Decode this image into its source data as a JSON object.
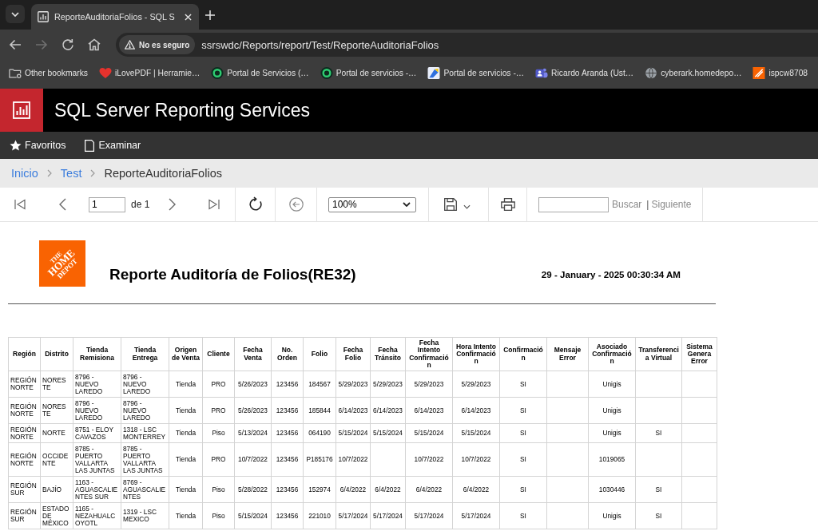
{
  "browser": {
    "tabs": [
      {
        "title": "ReporteAuditoriaFolios - SQL S",
        "selected": true
      }
    ],
    "nav_buttons": [
      {
        "kind": "back",
        "disabled": false
      },
      {
        "kind": "forward",
        "disabled": true
      },
      {
        "kind": "reload",
        "disabled": false
      },
      {
        "kind": "home",
        "disabled": false
      }
    ],
    "security_chip": "No es seguro",
    "url": "ssrswdc/Reports/report/Test/ReporteAuditoriaFolios",
    "bookmarks": [
      {
        "kind": "folder",
        "label": "Other bookmarks"
      },
      {
        "kind": "heart",
        "label": "iLovePDF | Herramie…"
      },
      {
        "kind": "ring",
        "label": "Portal de Servicios (…"
      },
      {
        "kind": "ring",
        "label": "Portal de servicios -…"
      },
      {
        "kind": "page",
        "label": "Portal de servicios -…"
      },
      {
        "kind": "people",
        "label": "Ricardo Aranda (Ust…"
      },
      {
        "kind": "globe",
        "label": "cyberark.homedepo…"
      },
      {
        "kind": "tile",
        "label": "ispcw8708"
      }
    ]
  },
  "app": {
    "title": "SQL Server Reporting Services",
    "nav": [
      {
        "kind": "star",
        "label": "Favoritos"
      },
      {
        "kind": "document",
        "label": "Examinar"
      }
    ],
    "breadcrumb": [
      {
        "label": "Inicio",
        "current": false
      },
      {
        "label": "Test",
        "current": false
      },
      {
        "label": "ReporteAuditoriaFolios",
        "current": true
      }
    ]
  },
  "report_toolbar": {
    "page": "1",
    "page_count": "de 1",
    "zoom": "100%",
    "find_button": "Buscar",
    "separator": "|",
    "next_button": "Siguiente"
  },
  "report": {
    "logo_text": [
      "THE",
      "HOME",
      "DEPOT"
    ],
    "title": "Reporte Auditoría de Folios(RE32)",
    "timestamp": "29 - January - 2025 00:30:34 AM",
    "table": {
      "columns": [
        "Región",
        "Distrito",
        "Tienda Remisiona",
        "Tienda Entrega",
        "Origen de Venta",
        "Cliente",
        "Fecha Venta",
        "No. Orden",
        "Folio",
        "Fecha Folio",
        "Fecha Tránsito",
        "Fecha Intento Confirmación",
        "Hora Intento Confirmación",
        "Confirmación",
        "Mensaje Error",
        "Asociado Confirmación",
        "Transferencia Virtual",
        "Sistema Genera Error"
      ],
      "rows": [
        [
          "REGIÓN NORTE",
          "NORESTE",
          "8796 - NUEVO LAREDO",
          "8796 - NUEVO LAREDO",
          "Tienda",
          "PRO",
          "5/26/2023",
          "123456",
          "184567",
          "5/29/2023",
          "5/29/2023",
          "5/29/2023",
          "5/29/2023",
          "SI",
          null,
          "Unigis",
          null,
          null
        ],
        [
          "REGIÓN NORTE",
          "NORESTE",
          "8796 - NUEVO LAREDO",
          "8796 - NUEVO LAREDO",
          "Tienda",
          "PRO",
          "5/26/2023",
          "123456",
          "185844",
          "6/14/2023",
          "6/14/2023",
          "6/14/2023",
          "6/14/2023",
          "SI",
          null,
          "Unigis",
          null,
          null
        ],
        [
          "REGIÓN NORTE",
          "NORTE",
          "8751 - ELOY CAVAZOS",
          "1318 - LSC MONTERREY",
          "Tienda",
          "Piso",
          "5/13/2024",
          "123456",
          "064190",
          "5/15/2024",
          "5/15/2024",
          "5/15/2024",
          "5/15/2024",
          "SI",
          null,
          "Unigis",
          "SI",
          null
        ],
        [
          "REGIÓN NORTE",
          "OCCIDENTE",
          "8785 - PUERTO VALLARTA LAS JUNTAS",
          "8785 - PUERTO VALLARTA LAS JUNTAS",
          "Tienda",
          "PRO",
          "10/7/2022",
          "123456",
          "P185176",
          "10/7/2022",
          null,
          "10/7/2022",
          "10/7/2022",
          "SI",
          null,
          "1019065",
          null,
          null
        ],
        [
          "REGIÓN SUR",
          "BAJÍO",
          "1163 - AGUASCALIENTES SUR",
          "8769 - AGUASCALIENTES",
          "Tienda",
          "Piso",
          "5/28/2022",
          "123456",
          "152974",
          "6/4/2022",
          "6/4/2022",
          "6/4/2022",
          "6/4/2022",
          "SI",
          null,
          "1030446",
          "SI",
          null
        ],
        [
          "REGIÓN SUR",
          "ESTADO DE MÉXICO",
          "1165 - NEZAHUALCOYOTL",
          "1319 - LSC MEXICO",
          "Tienda",
          "Piso",
          "5/15/2024",
          "123456",
          "221010",
          "5/17/2024",
          "5/17/2024",
          "5/17/2024",
          "5/17/2024",
          "SI",
          null,
          "Unigis",
          "SI",
          null
        ]
      ]
    }
  }
}
